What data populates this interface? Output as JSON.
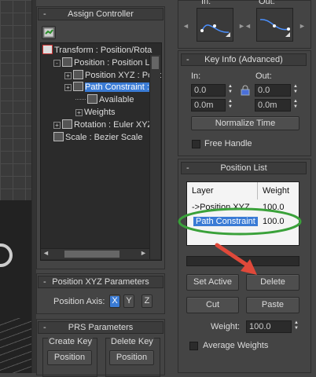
{
  "assign_controller": {
    "title": "Assign Controller",
    "tree": [
      {
        "label": "Transform : Position/Rota",
        "indent": 0,
        "expander": "",
        "selected": false
      },
      {
        "label": "Position : Position List",
        "indent": 1,
        "expander": "-",
        "selected": false
      },
      {
        "label": "Position XYZ : Posit",
        "indent": 2,
        "expander": "+",
        "selected": false
      },
      {
        "label": "Path Constraint : P",
        "indent": 2,
        "expander": "+",
        "selected": true
      },
      {
        "label": "Available",
        "indent": 3,
        "expander": "",
        "selected": false
      },
      {
        "label": "Weights",
        "indent": 3,
        "expander": "+",
        "selected": false
      },
      {
        "label": "Rotation : Euler XYZ",
        "indent": 1,
        "expander": "+",
        "selected": false
      },
      {
        "label": "Scale : Bezier Scale",
        "indent": 1,
        "expander": "",
        "selected": false
      }
    ]
  },
  "key_ease": {
    "in_label": "In:",
    "out_label": "Out:"
  },
  "key_info": {
    "title": "Key Info (Advanced)",
    "in_label": "In:",
    "out_label": "Out:",
    "in_value": "0.0",
    "out_value": "0.0",
    "in_time": "0.0m",
    "out_time": "0.0m",
    "normalize_label": "Normalize Time",
    "free_handle_label": "Free Handle"
  },
  "position_list": {
    "title": "Position List",
    "col_layer": "Layer",
    "col_weight": "Weight",
    "rows": [
      {
        "layer": "->Position XYZ",
        "weight": "100.0"
      },
      {
        "layer": "Path Constraint",
        "weight": "100.0"
      }
    ],
    "set_active_label": "Set Active",
    "delete_label": "Delete",
    "cut_label": "Cut",
    "paste_label": "Paste",
    "weight_label": "Weight:",
    "weight_value": "100.0",
    "average_weights_label": "Average Weights"
  },
  "xyz_params": {
    "title": "Position XYZ Parameters",
    "axis_label": "Position Axis:",
    "x": "X",
    "y": "Y",
    "z": "Z",
    "active_axis": "X"
  },
  "prs": {
    "title": "PRS Parameters",
    "create_key_label": "Create Key",
    "delete_key_label": "Delete Key",
    "create_position": "Position",
    "delete_position": "Position"
  },
  "colors": {
    "highlight": "#3a7bd5",
    "annotation_green": "#3aa13a",
    "annotation_red": "#e0493a"
  }
}
